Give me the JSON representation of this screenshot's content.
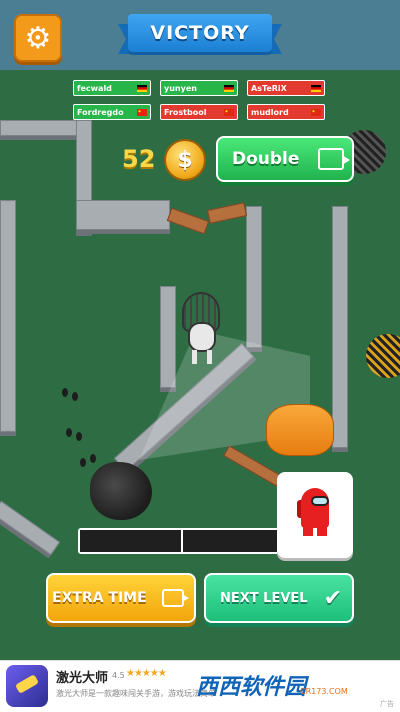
{
  "header": {
    "title": "VICTORY",
    "settings_icon": "gear-icon"
  },
  "players": [
    {
      "name": "fecwald",
      "flag_colors": [
        "#000000",
        "#d00000",
        "#ffce00"
      ]
    },
    {
      "name": "yunyen",
      "flag_colors": [
        "#000000",
        "#d00000",
        "#ffce00"
      ]
    },
    {
      "name": "AsTeRiX",
      "flag_colors": [
        "#000000",
        "#d00000",
        "#ffce00"
      ]
    },
    {
      "name": "Fordregdo",
      "flag_colors": [
        "#de2910",
        "#de2910",
        "#ffde00"
      ]
    },
    {
      "name": "Frostbool",
      "flag_colors": [
        "#de2910",
        "#de2910",
        "#ffde00"
      ]
    },
    {
      "name": "mudlord",
      "flag_colors": [
        "#de2910",
        "#de2910",
        "#ffde00"
      ]
    }
  ],
  "reward": {
    "coins": "52",
    "coin_symbol": "$",
    "double_label": "Double"
  },
  "progress": {
    "value": 0.5,
    "segments": 2
  },
  "buttons": {
    "extra_time": "EXTRA TIME",
    "next_level": "NEXT LEVEL"
  },
  "ad": {
    "app_name": "激光大师",
    "rating": "4.5",
    "stars": "★★★★★",
    "description": "激光大师是一款趣味闯关手游，游戏玩法简单",
    "logo": "西西软件园",
    "site": "CR173.COM",
    "ad_label": "广告"
  },
  "colors": {
    "tag_green": "#28b64b",
    "tag_red": "#e23a2e",
    "ground": "#2e6d44",
    "ribbon": "#2c91e6"
  }
}
